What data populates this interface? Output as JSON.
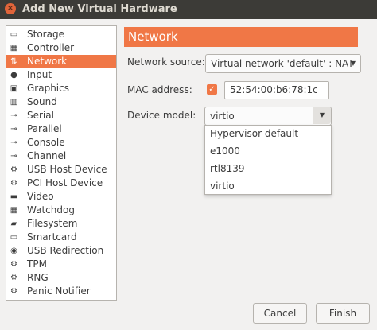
{
  "window": {
    "title": "Add New Virtual Hardware",
    "close_glyph": "×"
  },
  "sidebar": {
    "items": [
      {
        "label": "Storage",
        "icon": "storage-icon",
        "glyph": "▭"
      },
      {
        "label": "Controller",
        "icon": "controller-icon",
        "glyph": "▦"
      },
      {
        "label": "Network",
        "icon": "network-icon",
        "glyph": "⇅"
      },
      {
        "label": "Input",
        "icon": "mouse-icon",
        "glyph": "●"
      },
      {
        "label": "Graphics",
        "icon": "graphics-icon",
        "glyph": "▣"
      },
      {
        "label": "Sound",
        "icon": "sound-icon",
        "glyph": "▥"
      },
      {
        "label": "Serial",
        "icon": "serial-icon",
        "glyph": "⊸"
      },
      {
        "label": "Parallel",
        "icon": "parallel-icon",
        "glyph": "⊸"
      },
      {
        "label": "Console",
        "icon": "console-icon",
        "glyph": "⊸"
      },
      {
        "label": "Channel",
        "icon": "channel-icon",
        "glyph": "⊸"
      },
      {
        "label": "USB Host Device",
        "icon": "usb-host-icon",
        "glyph": "⚙"
      },
      {
        "label": "PCI Host Device",
        "icon": "pci-host-icon",
        "glyph": "⚙"
      },
      {
        "label": "Video",
        "icon": "video-icon",
        "glyph": "▬"
      },
      {
        "label": "Watchdog",
        "icon": "watchdog-icon",
        "glyph": "▦"
      },
      {
        "label": "Filesystem",
        "icon": "folder-icon",
        "glyph": "▰"
      },
      {
        "label": "Smartcard",
        "icon": "smartcard-icon",
        "glyph": "▭"
      },
      {
        "label": "USB Redirection",
        "icon": "usb-redirection-icon",
        "glyph": "◉"
      },
      {
        "label": "TPM",
        "icon": "tpm-icon",
        "glyph": "⚙"
      },
      {
        "label": "RNG",
        "icon": "rng-icon",
        "glyph": "⚙"
      },
      {
        "label": "Panic Notifier",
        "icon": "panic-notifier-icon",
        "glyph": "⚙"
      }
    ],
    "selected_index": 2
  },
  "main": {
    "header": "Network",
    "network_source": {
      "label": "Network source:",
      "value": "Virtual network 'default' : NAT",
      "arrow": "▼"
    },
    "mac_address": {
      "label": "MAC address:",
      "checked": true,
      "check_glyph": "✓",
      "value": "52:54:00:b6:78:1c"
    },
    "device_model": {
      "label": "Device model:",
      "value": "virtio",
      "arrow": "▼",
      "options": [
        "Hypervisor default",
        "e1000",
        "rtl8139",
        "virtio"
      ]
    }
  },
  "buttons": {
    "cancel": "Cancel",
    "finish": "Finish"
  },
  "colors": {
    "accent": "#f07746",
    "titlebar": "#3c3b37",
    "background": "#f2f1f0"
  }
}
